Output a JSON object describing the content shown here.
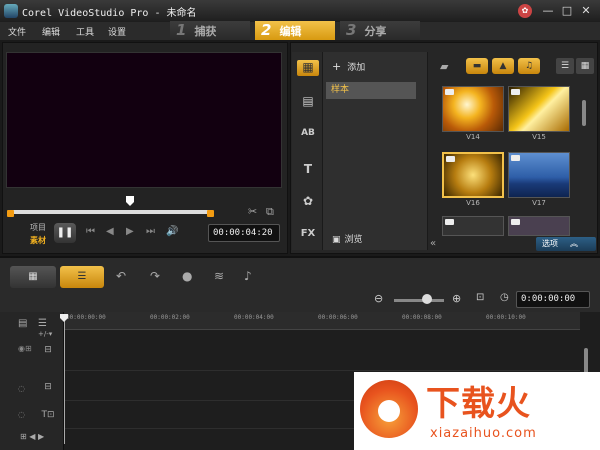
{
  "window": {
    "title": "Corel VideoStudio Pro - 未命名",
    "controls": [
      "—",
      "□",
      "✕"
    ]
  },
  "menu": [
    "文件",
    "编辑",
    "工具",
    "设置"
  ],
  "steps": [
    {
      "num": "1",
      "label": "捕获"
    },
    {
      "num": "2",
      "label": "编辑"
    },
    {
      "num": "3",
      "label": "分享"
    }
  ],
  "preview": {
    "project_label": "项目",
    "clip_label": "素材",
    "timecode": "00:00:04:20",
    "play_symbol": "❚❚"
  },
  "library": {
    "add_label": "添加",
    "sample_folder": "样本",
    "browse_label": "浏览",
    "options_label": "选项",
    "side_icons": [
      "▤",
      "AB",
      "T",
      "✿",
      "FX"
    ],
    "thumbs": [
      "V14",
      "V15",
      "V16",
      "V17"
    ]
  },
  "timeline": {
    "duration": "0:00:00:00",
    "ruler": [
      "00:00:00:00",
      "00:00:02:00",
      "00:00:04:00",
      "00:00:06:00",
      "00:00:08:00",
      "00:00:10:00"
    ]
  },
  "watermark": {
    "text": "下载火",
    "url": "xiazaihuo.com"
  },
  "colors": {
    "accent": "#f2c14a",
    "brand_watermark": "#e8531e"
  }
}
